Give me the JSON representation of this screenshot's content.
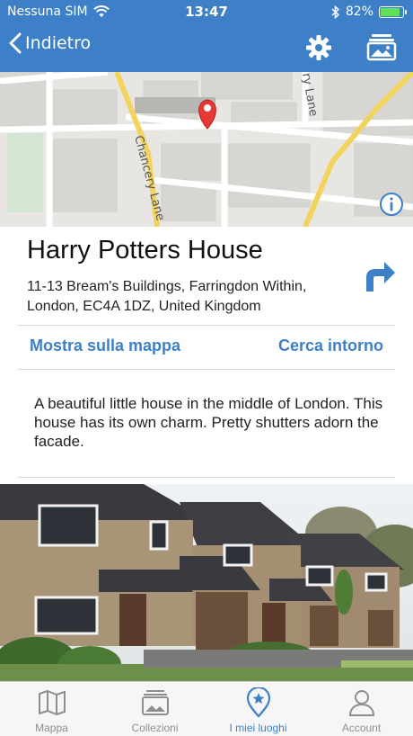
{
  "status_bar": {
    "carrier": "Nessuna SIM",
    "time": "13:47",
    "battery": "82%",
    "battery_level": 0.82,
    "icons": [
      "wifi-icon",
      "bluetooth-icon",
      "battery-icon"
    ]
  },
  "nav": {
    "back_label": "Indietro",
    "icons": [
      "chevron-left-icon",
      "gear-icon",
      "gallery-icon"
    ]
  },
  "map": {
    "street_labels": [
      "Chancery Lane",
      "ry Lane"
    ],
    "icons": [
      "map-pin-icon",
      "info-icon"
    ]
  },
  "place": {
    "title": "Harry Potters House",
    "address": "11-13 Bream's Buildings, Farringdon Within, London, EC4A 1DZ, United Kingdom",
    "actions": {
      "show_on_map": "Mostra sulla mappa",
      "search_nearby": "Cerca intorno"
    },
    "description": "A beautiful little house in the middle of London. This house has its own charm. Pretty shutters adorn the facade."
  },
  "tabs": [
    {
      "label": "Mappa",
      "icon": "map-icon",
      "active": false
    },
    {
      "label": "Collezioni",
      "icon": "collections-icon",
      "active": false
    },
    {
      "label": "I miei luoghi",
      "icon": "location-pin-star-icon",
      "active": true
    },
    {
      "label": "Account",
      "icon": "user-icon",
      "active": false
    }
  ],
  "colors": {
    "accent": "#3d80c8",
    "inactive": "#8e8e8e",
    "pin": "#e53935"
  }
}
